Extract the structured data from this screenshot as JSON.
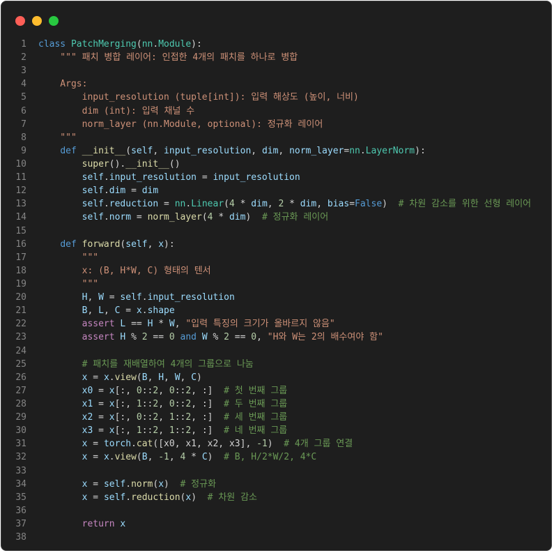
{
  "window": {
    "buttons": [
      "close",
      "minimize",
      "maximize"
    ]
  },
  "code": {
    "language": "python",
    "lines": [
      {
        "n": "1",
        "tokens": [
          [
            "kw",
            "class "
          ],
          [
            "cls",
            "PatchMerging"
          ],
          [
            "op",
            "("
          ],
          [
            "cls",
            "nn"
          ],
          [
            "op",
            "."
          ],
          [
            "cls",
            "Module"
          ],
          [
            "op",
            "):"
          ]
        ]
      },
      {
        "n": "2",
        "tokens": [
          [
            "str",
            "    \"\"\" 패치 병합 레이어: 인접한 4개의 패치를 하나로 병합"
          ]
        ]
      },
      {
        "n": "3",
        "tokens": []
      },
      {
        "n": "4",
        "tokens": [
          [
            "str",
            "    Args:"
          ]
        ]
      },
      {
        "n": "5",
        "tokens": [
          [
            "str",
            "        input_resolution (tuple[int]): 입력 해상도 (높이, 너비)"
          ]
        ]
      },
      {
        "n": "6",
        "tokens": [
          [
            "str",
            "        dim (int): 입력 채널 수"
          ]
        ]
      },
      {
        "n": "7",
        "tokens": [
          [
            "str",
            "        norm_layer (nn.Module, optional): 정규화 레이어"
          ]
        ]
      },
      {
        "n": "8",
        "tokens": [
          [
            "str",
            "    \"\"\""
          ]
        ]
      },
      {
        "n": "9",
        "tokens": [
          [
            "op",
            "    "
          ],
          [
            "kw",
            "def "
          ],
          [
            "fn",
            "__init__"
          ],
          [
            "op",
            "("
          ],
          [
            "var",
            "self"
          ],
          [
            "op",
            ", "
          ],
          [
            "var",
            "input_resolution"
          ],
          [
            "op",
            ", "
          ],
          [
            "var",
            "dim"
          ],
          [
            "op",
            ", "
          ],
          [
            "var",
            "norm_layer"
          ],
          [
            "op",
            "="
          ],
          [
            "cls",
            "nn"
          ],
          [
            "op",
            "."
          ],
          [
            "cls",
            "LayerNorm"
          ],
          [
            "op",
            "):"
          ]
        ]
      },
      {
        "n": "10",
        "tokens": [
          [
            "op",
            "        "
          ],
          [
            "fn",
            "super"
          ],
          [
            "op",
            "()."
          ],
          [
            "fn",
            "__init__"
          ],
          [
            "op",
            "()"
          ]
        ]
      },
      {
        "n": "11",
        "tokens": [
          [
            "op",
            "        "
          ],
          [
            "var",
            "self"
          ],
          [
            "op",
            "."
          ],
          [
            "var",
            "input_resolution"
          ],
          [
            "op",
            " = "
          ],
          [
            "var",
            "input_resolution"
          ]
        ]
      },
      {
        "n": "12",
        "tokens": [
          [
            "op",
            "        "
          ],
          [
            "var",
            "self"
          ],
          [
            "op",
            "."
          ],
          [
            "var",
            "dim"
          ],
          [
            "op",
            " = "
          ],
          [
            "var",
            "dim"
          ]
        ]
      },
      {
        "n": "13",
        "tokens": [
          [
            "op",
            "        "
          ],
          [
            "var",
            "self"
          ],
          [
            "op",
            "."
          ],
          [
            "var",
            "reduction"
          ],
          [
            "op",
            " = "
          ],
          [
            "cls",
            "nn"
          ],
          [
            "op",
            "."
          ],
          [
            "cls",
            "Linear"
          ],
          [
            "op",
            "("
          ],
          [
            "num",
            "4"
          ],
          [
            "op",
            " * "
          ],
          [
            "var",
            "dim"
          ],
          [
            "op",
            ", "
          ],
          [
            "num",
            "2"
          ],
          [
            "op",
            " * "
          ],
          [
            "var",
            "dim"
          ],
          [
            "op",
            ", "
          ],
          [
            "var",
            "bias"
          ],
          [
            "op",
            "="
          ],
          [
            "kw",
            "False"
          ],
          [
            "op",
            ")  "
          ],
          [
            "cmt",
            "# 차원 감소를 위한 선형 레이어"
          ]
        ]
      },
      {
        "n": "14",
        "tokens": [
          [
            "op",
            "        "
          ],
          [
            "var",
            "self"
          ],
          [
            "op",
            "."
          ],
          [
            "var",
            "norm"
          ],
          [
            "op",
            " = "
          ],
          [
            "fn",
            "norm_layer"
          ],
          [
            "op",
            "("
          ],
          [
            "num",
            "4"
          ],
          [
            "op",
            " * "
          ],
          [
            "var",
            "dim"
          ],
          [
            "op",
            ")  "
          ],
          [
            "cmt",
            "# 정규화 레이어"
          ]
        ]
      },
      {
        "n": "15",
        "tokens": []
      },
      {
        "n": "16",
        "tokens": [
          [
            "op",
            "    "
          ],
          [
            "kw",
            "def "
          ],
          [
            "fn",
            "forward"
          ],
          [
            "op",
            "("
          ],
          [
            "var",
            "self"
          ],
          [
            "op",
            ", "
          ],
          [
            "var",
            "x"
          ],
          [
            "op",
            "):"
          ]
        ]
      },
      {
        "n": "17",
        "tokens": [
          [
            "str",
            "        \"\"\""
          ]
        ]
      },
      {
        "n": "18",
        "tokens": [
          [
            "str",
            "        x: (B, H*W, C) 형태의 텐서"
          ]
        ]
      },
      {
        "n": "19",
        "tokens": [
          [
            "str",
            "        \"\"\""
          ]
        ]
      },
      {
        "n": "20",
        "tokens": [
          [
            "op",
            "        "
          ],
          [
            "var",
            "H"
          ],
          [
            "op",
            ", "
          ],
          [
            "var",
            "W"
          ],
          [
            "op",
            " = "
          ],
          [
            "var",
            "self"
          ],
          [
            "op",
            "."
          ],
          [
            "var",
            "input_resolution"
          ]
        ]
      },
      {
        "n": "21",
        "tokens": [
          [
            "op",
            "        "
          ],
          [
            "var",
            "B"
          ],
          [
            "op",
            ", "
          ],
          [
            "var",
            "L"
          ],
          [
            "op",
            ", "
          ],
          [
            "var",
            "C"
          ],
          [
            "op",
            " = "
          ],
          [
            "var",
            "x"
          ],
          [
            "op",
            "."
          ],
          [
            "var",
            "shape"
          ]
        ]
      },
      {
        "n": "22",
        "tokens": [
          [
            "op",
            "        "
          ],
          [
            "ctl",
            "assert "
          ],
          [
            "var",
            "L"
          ],
          [
            "op",
            " == "
          ],
          [
            "var",
            "H"
          ],
          [
            "op",
            " * "
          ],
          [
            "var",
            "W"
          ],
          [
            "op",
            ", "
          ],
          [
            "str",
            "\"입력 특징의 크기가 올바르지 않음\""
          ]
        ]
      },
      {
        "n": "23",
        "tokens": [
          [
            "op",
            "        "
          ],
          [
            "ctl",
            "assert "
          ],
          [
            "var",
            "H"
          ],
          [
            "op",
            " % "
          ],
          [
            "num",
            "2"
          ],
          [
            "op",
            " == "
          ],
          [
            "num",
            "0"
          ],
          [
            "kw",
            " and "
          ],
          [
            "var",
            "W"
          ],
          [
            "op",
            " % "
          ],
          [
            "num",
            "2"
          ],
          [
            "op",
            " == "
          ],
          [
            "num",
            "0"
          ],
          [
            "op",
            ", "
          ],
          [
            "str",
            "\"H와 W는 2의 배수여야 함\""
          ]
        ]
      },
      {
        "n": "24",
        "tokens": []
      },
      {
        "n": "25",
        "tokens": [
          [
            "op",
            "        "
          ],
          [
            "cmt",
            "# 패치를 재배열하여 4개의 그룹으로 나눔"
          ]
        ]
      },
      {
        "n": "26",
        "tokens": [
          [
            "op",
            "        "
          ],
          [
            "var",
            "x"
          ],
          [
            "op",
            " = "
          ],
          [
            "var",
            "x"
          ],
          [
            "op",
            "."
          ],
          [
            "fn",
            "view"
          ],
          [
            "op",
            "("
          ],
          [
            "var",
            "B"
          ],
          [
            "op",
            ", "
          ],
          [
            "var",
            "H"
          ],
          [
            "op",
            ", "
          ],
          [
            "var",
            "W"
          ],
          [
            "op",
            ", "
          ],
          [
            "var",
            "C"
          ],
          [
            "op",
            ")"
          ]
        ]
      },
      {
        "n": "27",
        "tokens": [
          [
            "op",
            "        "
          ],
          [
            "var",
            "x0"
          ],
          [
            "op",
            " = "
          ],
          [
            "var",
            "x"
          ],
          [
            "op",
            "[:, "
          ],
          [
            "num",
            "0"
          ],
          [
            "op",
            "::"
          ],
          [
            "num",
            "2"
          ],
          [
            "op",
            ", "
          ],
          [
            "num",
            "0"
          ],
          [
            "op",
            "::"
          ],
          [
            "num",
            "2"
          ],
          [
            "op",
            ", :]  "
          ],
          [
            "cmt",
            "# 첫 번째 그룹"
          ]
        ]
      },
      {
        "n": "28",
        "tokens": [
          [
            "op",
            "        "
          ],
          [
            "var",
            "x1"
          ],
          [
            "op",
            " = "
          ],
          [
            "var",
            "x"
          ],
          [
            "op",
            "[:, "
          ],
          [
            "num",
            "1"
          ],
          [
            "op",
            "::"
          ],
          [
            "num",
            "2"
          ],
          [
            "op",
            ", "
          ],
          [
            "num",
            "0"
          ],
          [
            "op",
            "::"
          ],
          [
            "num",
            "2"
          ],
          [
            "op",
            ", :]  "
          ],
          [
            "cmt",
            "# 두 번째 그룹"
          ]
        ]
      },
      {
        "n": "29",
        "tokens": [
          [
            "op",
            "        "
          ],
          [
            "var",
            "x2"
          ],
          [
            "op",
            " = "
          ],
          [
            "var",
            "x"
          ],
          [
            "op",
            "[:, "
          ],
          [
            "num",
            "0"
          ],
          [
            "op",
            "::"
          ],
          [
            "num",
            "2"
          ],
          [
            "op",
            ", "
          ],
          [
            "num",
            "1"
          ],
          [
            "op",
            "::"
          ],
          [
            "num",
            "2"
          ],
          [
            "op",
            ", :]  "
          ],
          [
            "cmt",
            "# 세 번째 그룹"
          ]
        ]
      },
      {
        "n": "30",
        "tokens": [
          [
            "op",
            "        "
          ],
          [
            "var",
            "x3"
          ],
          [
            "op",
            " = "
          ],
          [
            "var",
            "x"
          ],
          [
            "op",
            "[:, "
          ],
          [
            "num",
            "1"
          ],
          [
            "op",
            "::"
          ],
          [
            "num",
            "2"
          ],
          [
            "op",
            ", "
          ],
          [
            "num",
            "1"
          ],
          [
            "op",
            "::"
          ],
          [
            "num",
            "2"
          ],
          [
            "op",
            ", :]  "
          ],
          [
            "cmt",
            "# 네 번째 그룹"
          ]
        ]
      },
      {
        "n": "31",
        "tokens": [
          [
            "op",
            "        "
          ],
          [
            "var",
            "x"
          ],
          [
            "op",
            " = "
          ],
          [
            "var",
            "torch"
          ],
          [
            "op",
            "."
          ],
          [
            "fn",
            "cat"
          ],
          [
            "op",
            "([x0, x1, x2, x3], "
          ],
          [
            "num",
            "-1"
          ],
          [
            "op",
            ")  "
          ],
          [
            "cmt",
            "# 4개 그룹 연결"
          ]
        ]
      },
      {
        "n": "32",
        "tokens": [
          [
            "op",
            "        "
          ],
          [
            "var",
            "x"
          ],
          [
            "op",
            " = "
          ],
          [
            "var",
            "x"
          ],
          [
            "op",
            "."
          ],
          [
            "fn",
            "view"
          ],
          [
            "op",
            "("
          ],
          [
            "var",
            "B"
          ],
          [
            "op",
            ", "
          ],
          [
            "num",
            "-1"
          ],
          [
            "op",
            ", "
          ],
          [
            "num",
            "4"
          ],
          [
            "op",
            " * "
          ],
          [
            "var",
            "C"
          ],
          [
            "op",
            ")  "
          ],
          [
            "cmt",
            "# B, H/2*W/2, 4*C"
          ]
        ]
      },
      {
        "n": "33",
        "tokens": []
      },
      {
        "n": "34",
        "tokens": [
          [
            "op",
            "        "
          ],
          [
            "var",
            "x"
          ],
          [
            "op",
            " = "
          ],
          [
            "var",
            "self"
          ],
          [
            "op",
            "."
          ],
          [
            "fn",
            "norm"
          ],
          [
            "op",
            "("
          ],
          [
            "var",
            "x"
          ],
          [
            "op",
            ")  "
          ],
          [
            "cmt",
            "# 정규화"
          ]
        ]
      },
      {
        "n": "35",
        "tokens": [
          [
            "op",
            "        "
          ],
          [
            "var",
            "x"
          ],
          [
            "op",
            " = "
          ],
          [
            "var",
            "self"
          ],
          [
            "op",
            "."
          ],
          [
            "fn",
            "reduction"
          ],
          [
            "op",
            "("
          ],
          [
            "var",
            "x"
          ],
          [
            "op",
            ")  "
          ],
          [
            "cmt",
            "# 차원 감소"
          ]
        ]
      },
      {
        "n": "36",
        "tokens": []
      },
      {
        "n": "37",
        "tokens": [
          [
            "op",
            "        "
          ],
          [
            "ctl",
            "return "
          ],
          [
            "var",
            "x"
          ]
        ]
      },
      {
        "n": "38",
        "tokens": []
      }
    ]
  }
}
